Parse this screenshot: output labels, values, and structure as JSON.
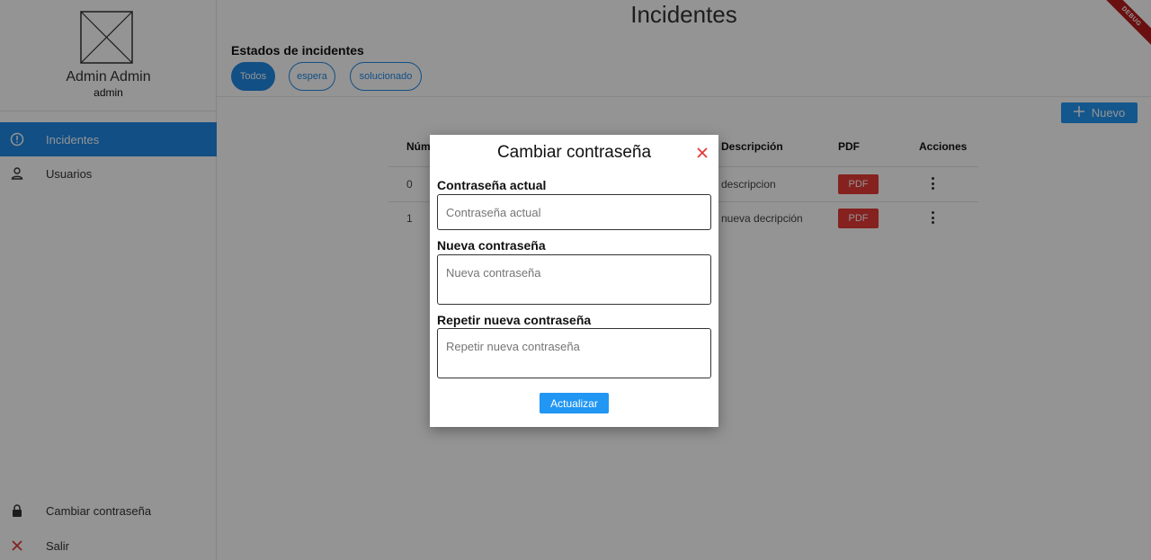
{
  "sidebar": {
    "user_name": "Admin Admin",
    "user_role": "admin",
    "nav": [
      {
        "label": "Incidentes",
        "icon": "alert-circle-icon"
      },
      {
        "label": "Usuarios",
        "icon": "person-icon"
      }
    ],
    "bottom": [
      {
        "label": "Cambiar contraseña",
        "icon": "lock-icon"
      },
      {
        "label": "Salir",
        "icon": "close-icon"
      }
    ]
  },
  "header": {
    "title": "Incidentes",
    "debug_banner": "DEBUG"
  },
  "filters": {
    "title": "Estados de incidentes",
    "chips": [
      "Todos",
      "espera",
      "solucionado"
    ],
    "selected": "Todos"
  },
  "toolbar": {
    "new_label": "Nuevo"
  },
  "table": {
    "headers": {
      "number": "Núm",
      "description": "Descripción",
      "pdf": "PDF",
      "actions": "Acciones"
    },
    "rows": [
      {
        "number": "0",
        "description": "descripcion",
        "pdf": "PDF"
      },
      {
        "number": "1",
        "description": "nueva decripción",
        "pdf": "PDF"
      }
    ]
  },
  "dialog": {
    "title": "Cambiar contraseña",
    "current_label": "Contraseña actual",
    "current_placeholder": "Contraseña actual",
    "new_label": "Nueva contraseña",
    "new_placeholder": "Nueva contraseña",
    "repeat_label": "Repetir nueva contraseña",
    "repeat_placeholder": "Repetir nueva contraseña",
    "submit_label": "Actualizar"
  },
  "colors": {
    "primary": "#1e88e5",
    "button": "#2196f3",
    "danger": "#e53935",
    "debug": "#b71c1c"
  }
}
